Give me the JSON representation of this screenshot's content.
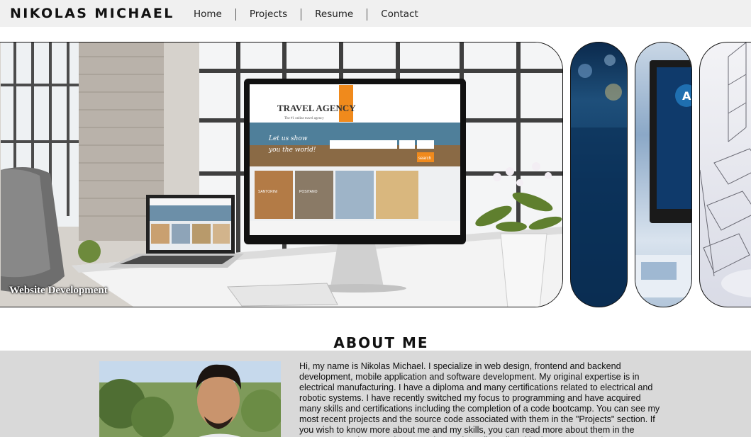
{
  "header": {
    "brand": "NIKOLAS MICHAEL",
    "nav": [
      {
        "label": "Home"
      },
      {
        "label": "Projects"
      },
      {
        "label": "Resume"
      },
      {
        "label": "Contact"
      }
    ]
  },
  "carousel": {
    "active_caption": "Website Development",
    "slides": [
      {
        "icon": "website-development-photo"
      },
      {
        "icon": "blue-abstract-photo"
      },
      {
        "icon": "monitor-app-photo"
      },
      {
        "icon": "blueprint-sketch-photo"
      }
    ],
    "mockup": {
      "site_name": "TRAVEL AGENCY",
      "tagline": "The #1 online travel agency",
      "hero_text": [
        "Let us show",
        "you the world!"
      ],
      "search_button": "search",
      "tiles": [
        "SANTORINI",
        "POSITANO"
      ]
    }
  },
  "about": {
    "title": "ABOUT ME",
    "text": "Hi, my name is Nikolas Michael. I specialize in web design, frontend and backend development, mobile application and software development. My original expertise is in electrical manufacturing. I have a diploma and many certifications related to electrical and robotic systems. I have recently switched my focus to programming and have acquired many skills and certifications including the completion of a code bootcamp. You can see my most recent projects and the source code associated with them in the \"Projects\" section. If you wish to know more about me and my skills, you can read more about them in the \"Resume\" section. My phone number and email are listed in the contact section."
  },
  "colors": {
    "header_bg": "#f0f0f0",
    "about_bg": "#d9d9d9",
    "accent_orange": "#f08a1c"
  }
}
